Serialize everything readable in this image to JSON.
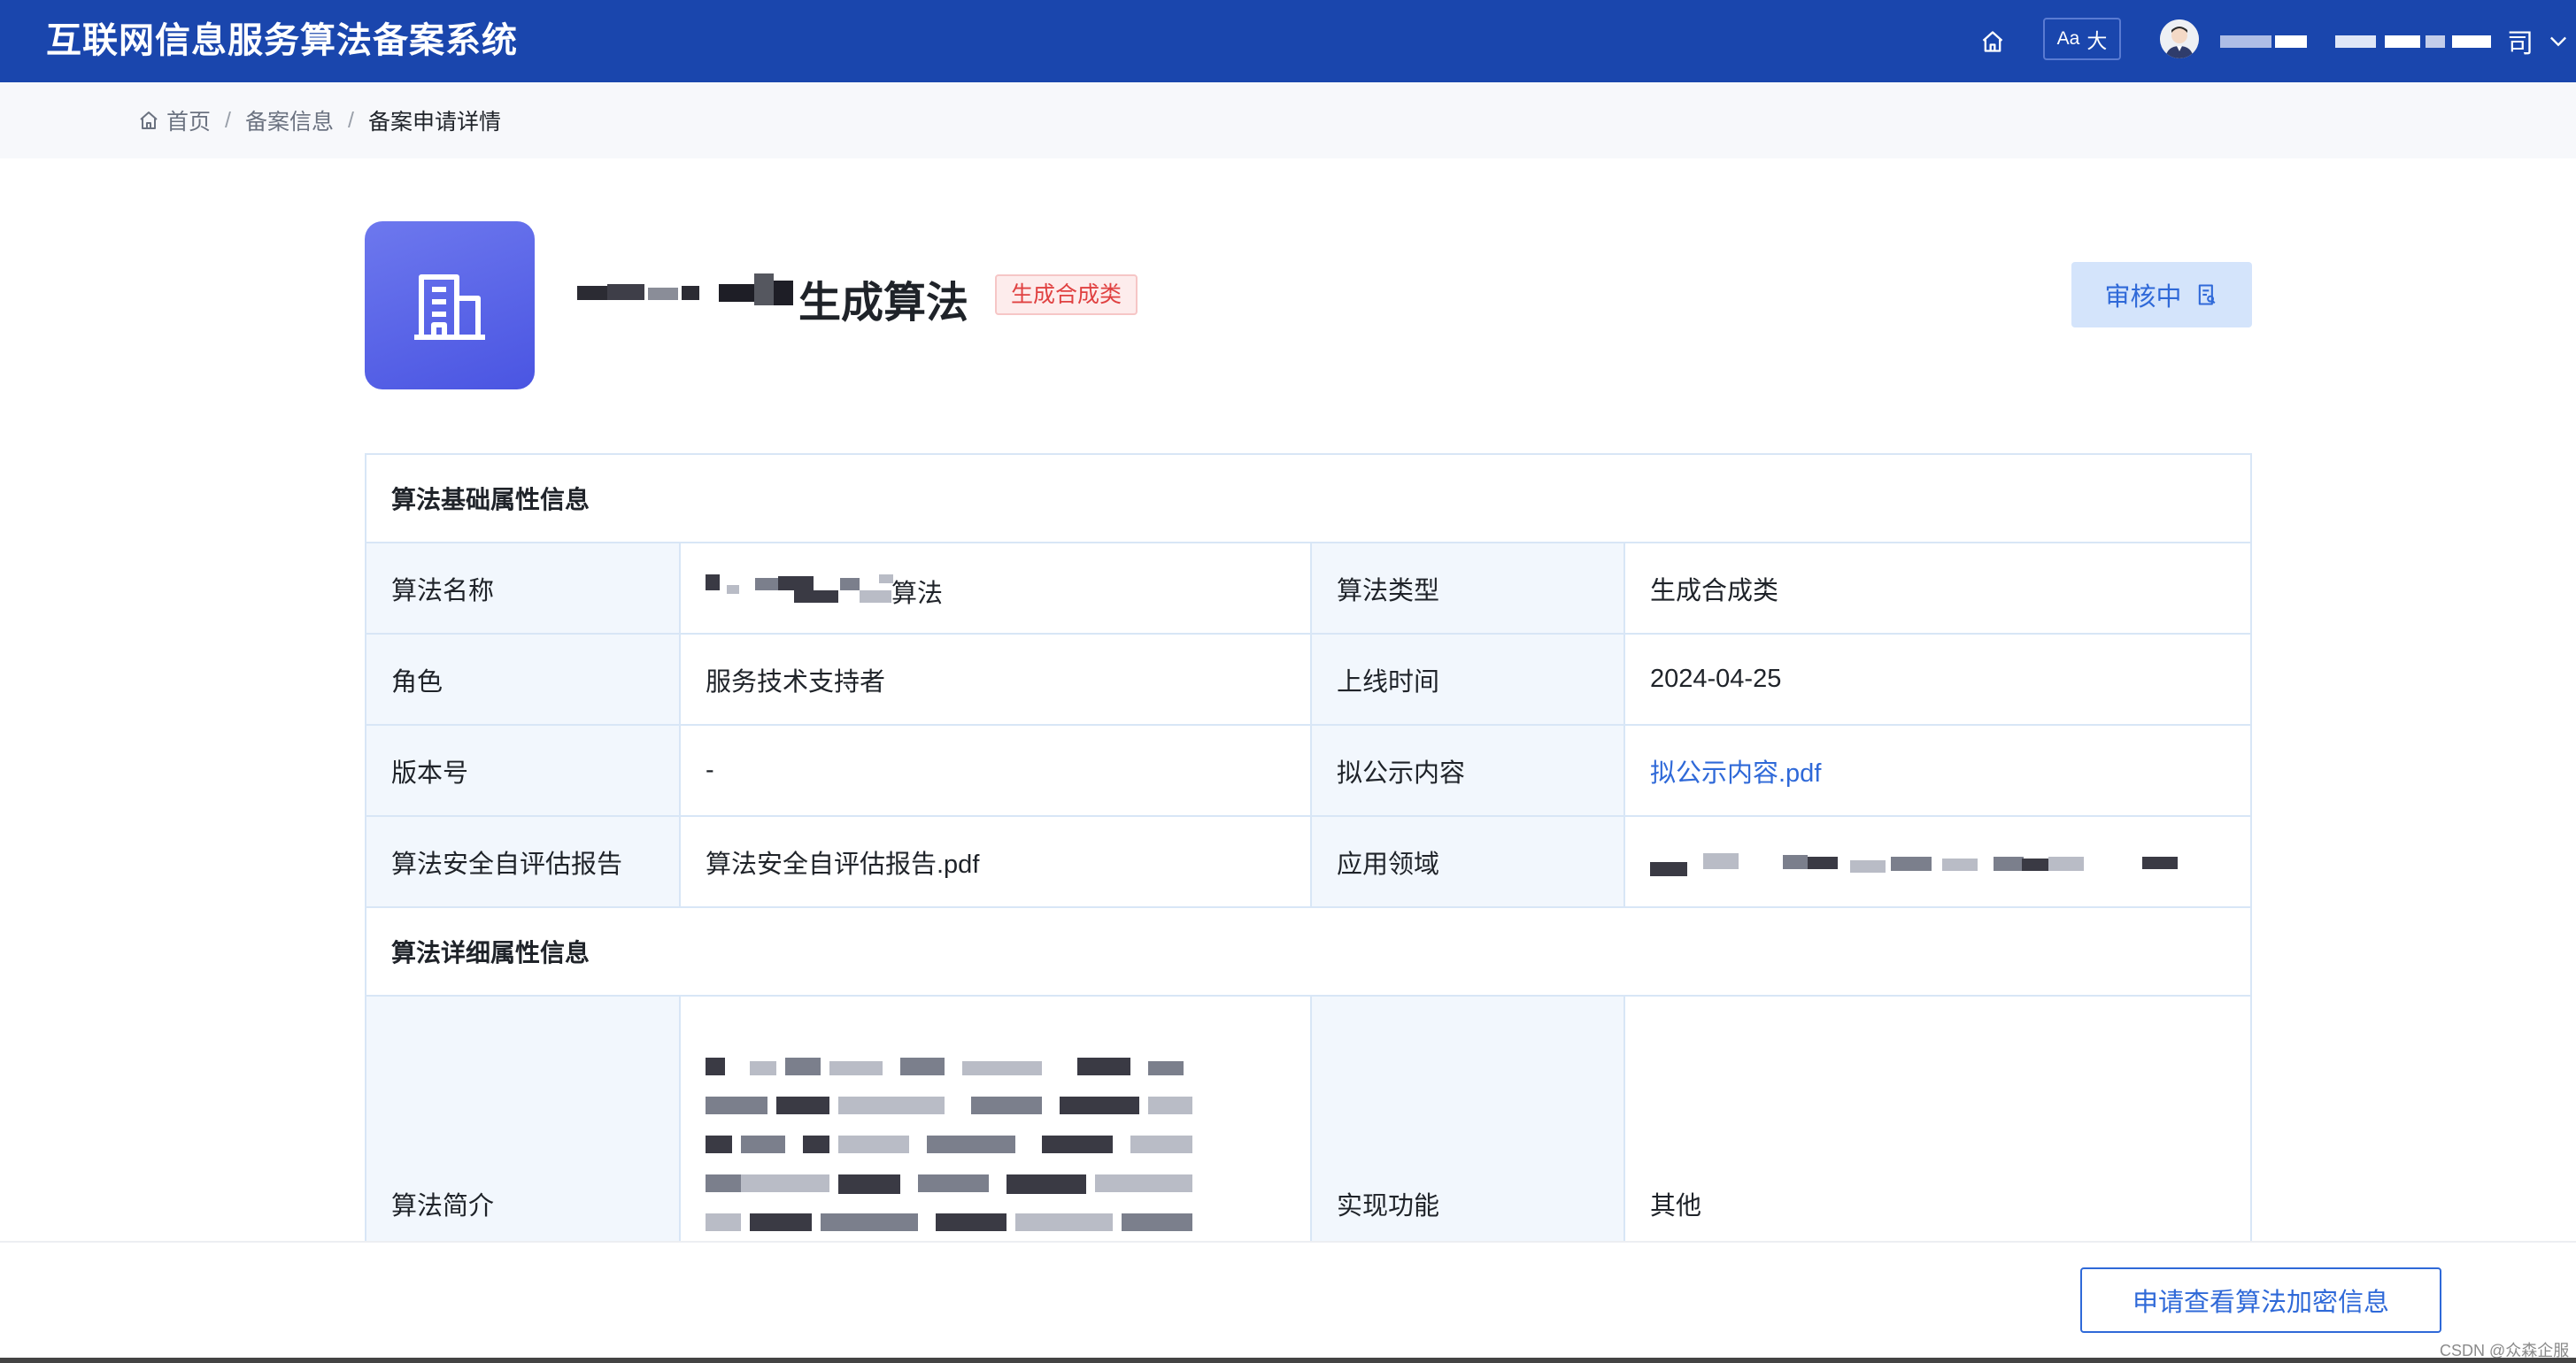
{
  "header": {
    "app_title": "互联网信息服务算法备案系统",
    "font_toggle_small": "Aa",
    "font_toggle_big": "大",
    "username_tail": "司"
  },
  "breadcrumb": {
    "home": "首页",
    "separator": "/",
    "items": [
      "备案信息",
      "备案申请详情"
    ]
  },
  "algorithm": {
    "title_suffix": "生成算法",
    "type_badge": "生成合成类",
    "status_button": "审核中"
  },
  "sections": {
    "basic_title": "算法基础属性信息",
    "detail_title": "算法详细属性信息"
  },
  "basic_rows": [
    {
      "k1": "算法名称",
      "v1_tail": "算法",
      "k2": "算法类型",
      "v2": "生成合成类"
    },
    {
      "k1": "角色",
      "v1": "服务技术支持者",
      "k2": "上线时间",
      "v2": "2024-04-25"
    },
    {
      "k1": "版本号",
      "v1": "-",
      "k2": "拟公示内容",
      "v2": "拟公示内容.pdf"
    },
    {
      "k1": "算法安全自评估报告",
      "v1": "算法安全自评估报告.pdf",
      "k2": "应用领域"
    }
  ],
  "detail_row": {
    "k1": "算法简介",
    "k2": "实现功能",
    "v2": "其他"
  },
  "footer": {
    "request_button": "申请查看算法加密信息",
    "watermark": "CSDN @众森企服"
  },
  "colors": {
    "header_bg": "#1a46ad",
    "accent": "#2f69d8",
    "badge_red": "#e04141",
    "key_cell_bg": "#f2f7fd"
  },
  "icons": [
    "home-icon",
    "font-size-icon",
    "avatar-icon",
    "chevron-down-icon",
    "building-icon",
    "document-icon"
  ]
}
